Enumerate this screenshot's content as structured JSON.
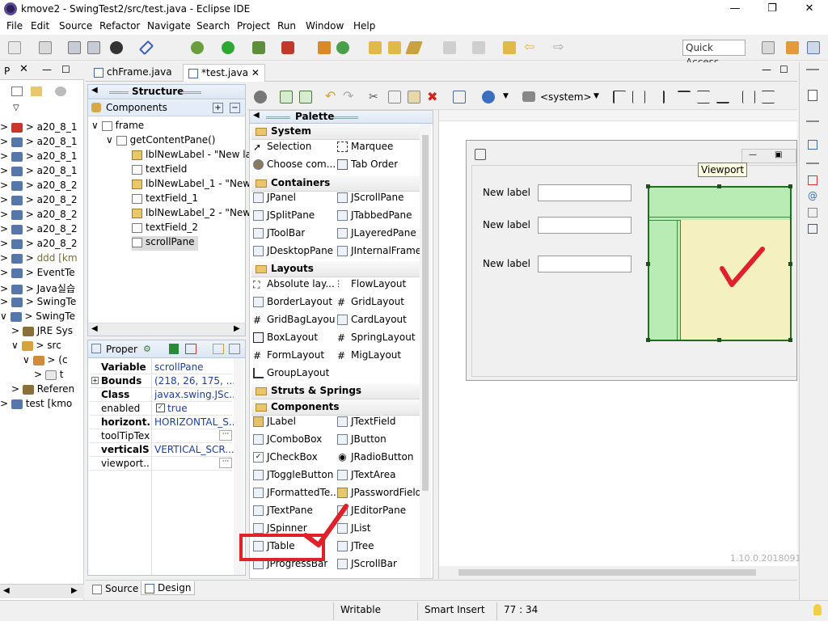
{
  "window": {
    "title": "kmove2 - SwingTest2/src/test.java - Eclipse IDE",
    "minimize": "—",
    "restore": "❐",
    "close": "✕"
  },
  "menu": [
    "File",
    "Edit",
    "Source",
    "Refactor",
    "Navigate",
    "Search",
    "Project",
    "Run",
    "Window",
    "Help"
  ],
  "toolbar": {
    "quick_access": "Quick Access"
  },
  "left_panel": {
    "tab_label": "P",
    "items": [
      "a20_8_1",
      "a20_8_1",
      "a20_8_1",
      "a20_8_1",
      "a20_8_2",
      "a20_8_2",
      "a20_8_2",
      "a20_8_2",
      "a20_8_2",
      "ddd [km",
      "EventTe",
      "Java실습",
      "SwingTe",
      "SwingTe",
      "JRE Sys",
      "src",
      "(c",
      "t",
      "Referen",
      "test [kmo"
    ]
  },
  "editor_tabs": [
    {
      "label": "chFrame.java"
    },
    {
      "label": "*test.java",
      "close": "✕"
    }
  ],
  "structure": {
    "title": "Structure",
    "components_label": "Components",
    "tree": [
      "frame",
      "getContentPane()",
      "lblNewLabel - \"New la",
      "textField",
      "lblNewLabel_1 - \"New",
      "textField_1",
      "lblNewLabel_2 - \"New",
      "textField_2",
      "scrollPane"
    ]
  },
  "properties": {
    "title": "Proper",
    "rows": [
      {
        "key": "Variable",
        "value": "scrollPane",
        "bold": true
      },
      {
        "key": "Bounds",
        "value": "(218, 26, 175, ...",
        "bold": true
      },
      {
        "key": "Class",
        "value": "javax.swing.JSc...",
        "bold": true
      },
      {
        "key": "enabled",
        "value": "true",
        "bold": false
      },
      {
        "key": "horizont...",
        "value": "HORIZONTAL_S...",
        "bold": true
      },
      {
        "key": "toolTipText",
        "value": "",
        "bold": false
      },
      {
        "key": "verticalS...",
        "value": "VERTICAL_SCR...",
        "bold": true
      },
      {
        "key": "viewport...",
        "value": "",
        "bold": false
      }
    ]
  },
  "design_toolbar": {
    "system_select": "<system>"
  },
  "palette": {
    "title": "Palette",
    "categories": [
      {
        "name": "System",
        "items": [
          "Selection",
          "Marquee",
          "Choose com...",
          "Tab Order"
        ]
      },
      {
        "name": "Containers",
        "items": [
          "JPanel",
          "JScrollPane",
          "JSplitPane",
          "JTabbedPane",
          "JToolBar",
          "JLayeredPane",
          "JDesktopPane",
          "JInternalFrame"
        ]
      },
      {
        "name": "Layouts",
        "items": [
          "Absolute lay...",
          "FlowLayout",
          "BorderLayout",
          "GridLayout",
          "GridBagLayout",
          "CardLayout",
          "BoxLayout",
          "SpringLayout",
          "FormLayout",
          "MigLayout",
          "GroupLayout"
        ]
      },
      {
        "name": "Struts & Springs",
        "items": []
      },
      {
        "name": "Components",
        "items": [
          "JLabel",
          "JTextField",
          "JComboBox",
          "JButton",
          "JCheckBox",
          "JRadioButton",
          "JToggleButton",
          "JTextArea",
          "JFormattedTe...",
          "JPasswordField",
          "JTextPane",
          "JEditorPane",
          "JSpinner",
          "JList",
          "JTable",
          "JTree",
          "JProgressBar",
          "JScrollBar"
        ]
      }
    ]
  },
  "design": {
    "labels": [
      "New label",
      "New label",
      "New label"
    ],
    "viewport_tooltip": "Viewport",
    "version": "1.10.0.2018091"
  },
  "bottom_tabs": [
    "Source",
    "Design"
  ],
  "status": {
    "writable": "Writable",
    "insert": "Smart Insert",
    "position": "77 : 34"
  },
  "colors": {
    "annotation_red": "#e0202a",
    "selection_green": "#b9ecb4",
    "viewport_yellow": "#f5f0c0",
    "accent_blue": "#3874d8"
  }
}
